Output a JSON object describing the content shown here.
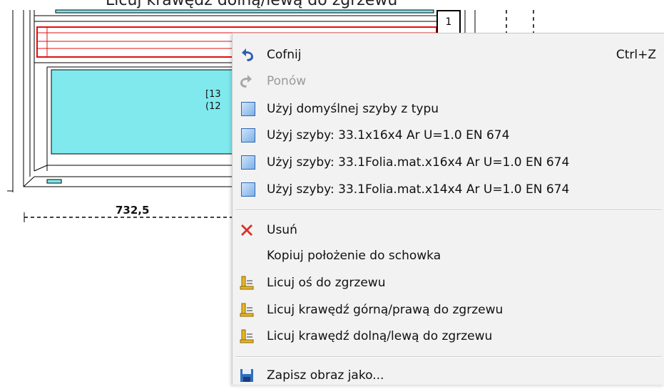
{
  "window": {
    "title_partial": "Licuj krawędź dolną/lewą do zgrzewu",
    "marker_number": "1",
    "glass_label_1": "[13",
    "glass_label_2": "(12",
    "dimension": "732,5"
  },
  "context_menu": {
    "items": [
      {
        "label": "Cofnij",
        "shortcut": "Ctrl+Z",
        "icon": "undo-icon",
        "enabled": true
      },
      {
        "label": "Ponów",
        "shortcut": "",
        "icon": "redo-icon",
        "enabled": false
      },
      {
        "label": "Użyj domyślnej szyby z typu",
        "icon": "glass-icon",
        "enabled": true
      },
      {
        "label": "Użyj szyby:  33.1x16x4 Ar U=1.0 EN 674",
        "icon": "glass-icon",
        "enabled": true
      },
      {
        "label": "Użyj szyby:  33.1Folia.mat.x16x4 Ar U=1.0 EN 674",
        "icon": "glass-icon",
        "enabled": true
      },
      {
        "label": "Użyj szyby:  33.1Folia.mat.x14x4 Ar U=1.0 EN 674",
        "icon": "glass-icon",
        "enabled": true
      },
      {
        "label": "Usuń",
        "icon": "delete-icon",
        "enabled": true
      },
      {
        "label": "Kopiuj położenie do schowka",
        "icon": "",
        "enabled": true
      },
      {
        "label": "Licuj oś do zgrzewu",
        "icon": "align-icon",
        "enabled": true
      },
      {
        "label": "Licuj krawędź górną/prawą do zgrzewu",
        "icon": "align-icon",
        "enabled": true
      },
      {
        "label": "Licuj krawędź dolną/lewą do zgrzewu",
        "icon": "align-icon",
        "enabled": true
      },
      {
        "label": "Zapisz obraz jako...",
        "icon": "save-icon",
        "enabled": true
      }
    ]
  },
  "colors": {
    "glass": "#7fe9ee",
    "selection": "#e01010",
    "menu_bg": "#f2f2f2"
  }
}
